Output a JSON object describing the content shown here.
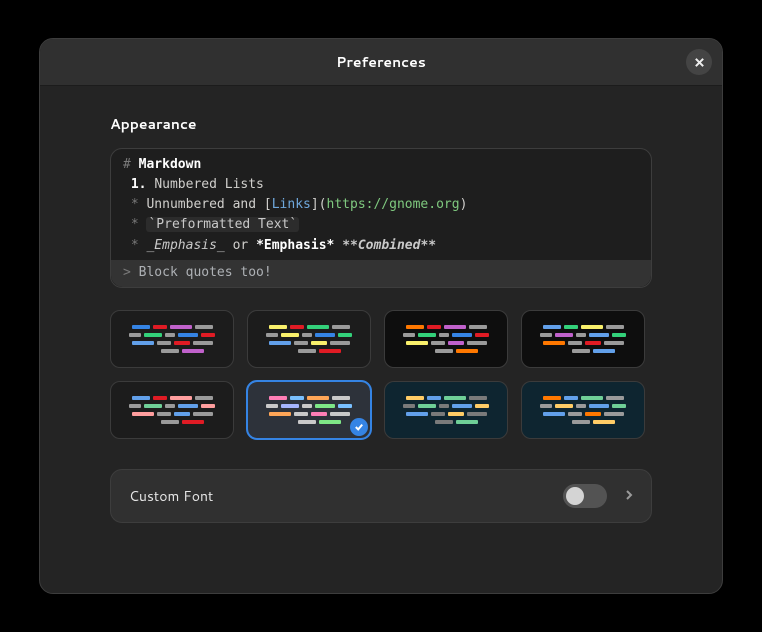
{
  "header": {
    "title": "Preferences"
  },
  "appearance": {
    "section_title": "Appearance",
    "preview": {
      "l1_hash": "#",
      "l1_title": "Markdown",
      "l2_num": "1.",
      "l2_text": "Numbered Lists",
      "bullet": "*",
      "l3a": "Unnumbered and [",
      "l3_link": "Links",
      "l3b": "](",
      "l3_url": "https://gnome.org",
      "l3c": ")",
      "l4_code": "`Preformatted Text`",
      "l5_em1": "_Emphasis_",
      "l5_or": " or ",
      "l5_em2": "*Emphasis*",
      "l5_sp": " ",
      "l5_comb": "**Combined**",
      "bq_arrow": ">",
      "bq_text": " Block quotes too!"
    },
    "themes": [
      {
        "id": 0,
        "bg": "dark",
        "selected": false,
        "rows": [
          [
            "#3584e4",
            "#e01b24",
            "#c061cb",
            "#9a9a9a"
          ],
          [
            "#9a9a9a",
            "#33d17a",
            "#9a9a9a",
            "#3584e4",
            "#e01b24"
          ],
          [
            "#62a0ea",
            "#9a9a9a",
            "#e01b24",
            "#9a9a9a"
          ],
          [
            "#9a9a9a",
            "#c061cb"
          ]
        ]
      },
      {
        "id": 1,
        "bg": "dark",
        "selected": false,
        "rows": [
          [
            "#f9f06b",
            "#e01b24",
            "#33d17a",
            "#9a9a9a"
          ],
          [
            "#9a9a9a",
            "#f9f06b",
            "#9a9a9a",
            "#3584e4",
            "#33d17a"
          ],
          [
            "#62a0ea",
            "#9a9a9a",
            "#f9f06b",
            "#9a9a9a"
          ],
          [
            "#9a9a9a",
            "#e01b24"
          ]
        ]
      },
      {
        "id": 2,
        "bg": "darker",
        "selected": false,
        "rows": [
          [
            "#ff7800",
            "#e01b24",
            "#c061cb",
            "#9a9a9a"
          ],
          [
            "#9a9a9a",
            "#33d17a",
            "#9a9a9a",
            "#3584e4",
            "#e01b24"
          ],
          [
            "#f9f06b",
            "#9a9a9a",
            "#c061cb",
            "#9a9a9a"
          ],
          [
            "#9a9a9a",
            "#ff7800"
          ]
        ]
      },
      {
        "id": 3,
        "bg": "darker",
        "selected": false,
        "rows": [
          [
            "#62a0ea",
            "#33d17a",
            "#f9f06b",
            "#9a9a9a"
          ],
          [
            "#9a9a9a",
            "#c061cb",
            "#9a9a9a",
            "#62a0ea",
            "#33d17a"
          ],
          [
            "#ff7800",
            "#9a9a9a",
            "#e01b24",
            "#9a9a9a"
          ],
          [
            "#9a9a9a",
            "#62a0ea"
          ]
        ]
      },
      {
        "id": 4,
        "bg": "dark",
        "selected": false,
        "rows": [
          [
            "#62a0ea",
            "#e01b24",
            "#ff9e9e",
            "#9a9a9a"
          ],
          [
            "#9a9a9a",
            "#6fcf97",
            "#9a9a9a",
            "#62a0ea",
            "#ff9e9e"
          ],
          [
            "#ff9e9e",
            "#9a9a9a",
            "#62a0ea",
            "#9a9a9a"
          ],
          [
            "#9a9a9a",
            "#e01b24"
          ]
        ]
      },
      {
        "id": 5,
        "bg": "gray",
        "selected": true,
        "rows": [
          [
            "#ff7eb6",
            "#79c0ff",
            "#ffa657",
            "#c9c9c9"
          ],
          [
            "#c9c9c9",
            "#a5b4fc",
            "#c9c9c9",
            "#7ee787",
            "#79c0ff"
          ],
          [
            "#ffa657",
            "#c9c9c9",
            "#ff7eb6",
            "#c9c9c9"
          ],
          [
            "#c9c9c9",
            "#7ee787"
          ]
        ]
      },
      {
        "id": 6,
        "bg": "teal",
        "selected": false,
        "rows": [
          [
            "#ffcc66",
            "#62a0ea",
            "#6fcf97",
            "#7a7a7a"
          ],
          [
            "#7a7a7a",
            "#6fcf97",
            "#7a7a7a",
            "#62a0ea",
            "#ffcc66"
          ],
          [
            "#62a0ea",
            "#7a7a7a",
            "#ffcc66",
            "#7a7a7a"
          ],
          [
            "#7a7a7a",
            "#6fcf97"
          ]
        ]
      },
      {
        "id": 7,
        "bg": "teal",
        "selected": false,
        "rows": [
          [
            "#ff7800",
            "#62a0ea",
            "#6fcf97",
            "#9a9a9a"
          ],
          [
            "#9a9a9a",
            "#ffcc66",
            "#9a9a9a",
            "#62a0ea",
            "#6fcf97"
          ],
          [
            "#62a0ea",
            "#9a9a9a",
            "#ff7800",
            "#9a9a9a"
          ],
          [
            "#9a9a9a",
            "#ffcc66"
          ]
        ]
      }
    ]
  },
  "rows": {
    "custom_font": {
      "label": "Custom Font",
      "enabled": false
    }
  }
}
